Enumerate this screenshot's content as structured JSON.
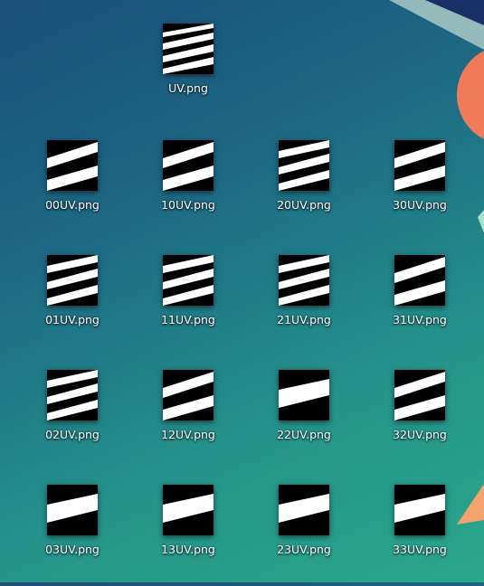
{
  "desktop": {
    "top_file": {
      "label": "UV.png",
      "thumb": "stripes-many"
    },
    "files": [
      {
        "label": "00UV.png",
        "thumb": "stripes-2"
      },
      {
        "label": "10UV.png",
        "thumb": "stripes-2"
      },
      {
        "label": "20UV.png",
        "thumb": "stripes-3"
      },
      {
        "label": "30UV.png",
        "thumb": "stripes-2"
      },
      {
        "label": "01UV.png",
        "thumb": "stripes-3"
      },
      {
        "label": "11UV.png",
        "thumb": "stripes-3"
      },
      {
        "label": "21UV.png",
        "thumb": "stripes-3"
      },
      {
        "label": "31UV.png",
        "thumb": "stripes-2"
      },
      {
        "label": "02UV.png",
        "thumb": "stripes-3"
      },
      {
        "label": "12UV.png",
        "thumb": "stripes-2"
      },
      {
        "label": "22UV.png",
        "thumb": "stripes-1"
      },
      {
        "label": "32UV.png",
        "thumb": "stripes-2"
      },
      {
        "label": "03UV.png",
        "thumb": "stripes-1"
      },
      {
        "label": "13UV.png",
        "thumb": "stripes-1"
      },
      {
        "label": "23UV.png",
        "thumb": "stripes-1"
      },
      {
        "label": "33UV.png",
        "thumb": "stripes-1"
      }
    ]
  },
  "colors": {
    "wallpaper_top": "#1b4f79",
    "wallpaper_bottom": "#2aa88a",
    "accent_orange": "#f07a5a"
  }
}
